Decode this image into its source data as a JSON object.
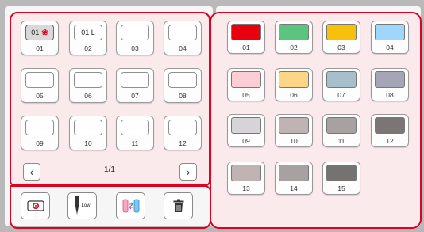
{
  "memory": {
    "slots": [
      {
        "label": "01",
        "content_text": "01",
        "has_icon": true,
        "selected": true
      },
      {
        "label": "02",
        "content_text": "01 L",
        "has_icon": false,
        "selected": false
      },
      {
        "label": "03",
        "content_text": "",
        "has_icon": false,
        "selected": false
      },
      {
        "label": "04",
        "content_text": "",
        "has_icon": false,
        "selected": false
      },
      {
        "label": "05",
        "content_text": "",
        "has_icon": false,
        "selected": false
      },
      {
        "label": "06",
        "content_text": "",
        "has_icon": false,
        "selected": false
      },
      {
        "label": "07",
        "content_text": "",
        "has_icon": false,
        "selected": false
      },
      {
        "label": "08",
        "content_text": "",
        "has_icon": false,
        "selected": false
      },
      {
        "label": "09",
        "content_text": "",
        "has_icon": false,
        "selected": false
      },
      {
        "label": "10",
        "content_text": "",
        "has_icon": false,
        "selected": false
      },
      {
        "label": "11",
        "content_text": "",
        "has_icon": false,
        "selected": false
      },
      {
        "label": "12",
        "content_text": "",
        "has_icon": false,
        "selected": false
      }
    ],
    "page_indicator": "1/1",
    "prev_icon": "chevron-left-icon",
    "next_icon": "chevron-right-icon"
  },
  "tools": [
    {
      "name": "memory-stitch-button",
      "icon": "pattern-memory-icon"
    },
    {
      "name": "needle-low-button",
      "icon": "needle-position-icon",
      "text": "Low"
    },
    {
      "name": "color-thread-button",
      "icon": "thread-color-swap-icon"
    },
    {
      "name": "delete-button",
      "icon": "trash-icon"
    }
  ],
  "colors": {
    "swatches": [
      {
        "label": "01",
        "color": "#e8000e"
      },
      {
        "label": "02",
        "color": "#5bc47f"
      },
      {
        "label": "03",
        "color": "#f7c00a"
      },
      {
        "label": "04",
        "color": "#9fd6fb"
      },
      {
        "label": "05",
        "color": "#fdcdd5"
      },
      {
        "label": "06",
        "color": "#fdd586"
      },
      {
        "label": "07",
        "color": "#a6bfca"
      },
      {
        "label": "08",
        "color": "#a5a5b5"
      },
      {
        "label": "09",
        "color": "#d7d4d8"
      },
      {
        "label": "10",
        "color": "#bfb4b4"
      },
      {
        "label": "11",
        "color": "#a8a1a1"
      },
      {
        "label": "12",
        "color": "#7b7675"
      },
      {
        "label": "13",
        "color": "#c0b3b3"
      },
      {
        "label": "14",
        "color": "#a8a1a1"
      },
      {
        "label": "15",
        "color": "#757272"
      }
    ]
  },
  "highlight_color": "#e00020"
}
